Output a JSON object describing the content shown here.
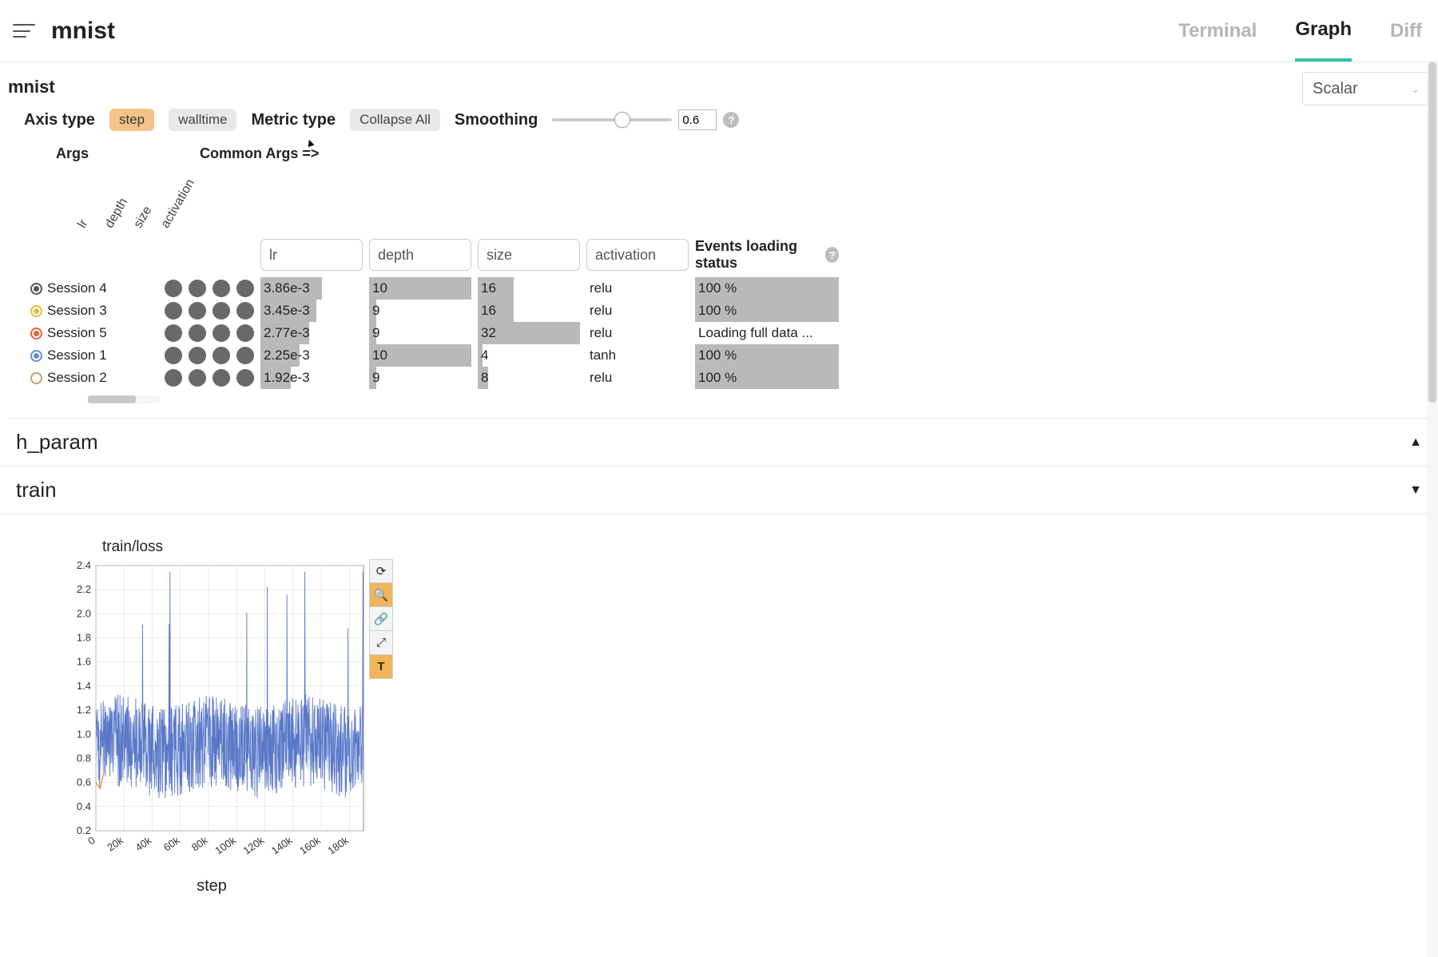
{
  "header": {
    "title": "mnist",
    "tabs": [
      {
        "label": "Terminal",
        "active": false
      },
      {
        "label": "Graph",
        "active": true
      },
      {
        "label": "Diff",
        "active": false
      }
    ]
  },
  "breadcrumb": "mnist",
  "tag_dropdown": "Scalar",
  "controls": {
    "axis_type_label": "Axis type",
    "axis_options": [
      {
        "label": "step",
        "active": true
      },
      {
        "label": "walltime",
        "active": false
      }
    ],
    "metric_type_label": "Metric type",
    "collapse_label": "Collapse All",
    "smoothing_label": "Smoothing",
    "smoothing_value": "0.6"
  },
  "args": {
    "heading": "Args",
    "common_label": "Common Args =>",
    "columns": [
      "lr",
      "depth",
      "size",
      "activation"
    ],
    "status_label": "Events loading status",
    "sessions": [
      {
        "name": "Session 4",
        "color": "#555",
        "selected": true,
        "lr": "3.86e-3",
        "lr_w": 60,
        "depth": "10",
        "depth_w": 100,
        "size": "16",
        "size_w": 35,
        "activation": "relu",
        "status": "100 %",
        "status_bar": true
      },
      {
        "name": "Session 3",
        "color": "#e0c040",
        "selected": true,
        "lr": "3.45e-3",
        "lr_w": 55,
        "depth": "9",
        "depth_w": 7,
        "size": "16",
        "size_w": 35,
        "activation": "relu",
        "status": "100 %",
        "status_bar": true
      },
      {
        "name": "Session 5",
        "color": "#e1643a",
        "selected": true,
        "lr": "2.77e-3",
        "lr_w": 48,
        "depth": "9",
        "depth_w": 7,
        "size": "32",
        "size_w": 100,
        "activation": "relu",
        "status": "Loading full data ...",
        "status_bar": false
      },
      {
        "name": "Session 1",
        "color": "#6a8ed8",
        "selected": true,
        "lr": "2.25e-3",
        "lr_w": 38,
        "depth": "10",
        "depth_w": 100,
        "size": "4",
        "size_w": 5,
        "activation": "tanh",
        "status": "100 %",
        "status_bar": true
      },
      {
        "name": "Session 2",
        "color": "#ffffff",
        "selected": false,
        "lr": "1.92e-3",
        "lr_w": 30,
        "depth": "9",
        "depth_w": 7,
        "size": "8",
        "size_w": 10,
        "activation": "relu",
        "status": "100 %",
        "status_bar": true
      }
    ]
  },
  "sections": [
    {
      "title": "h_param",
      "open": false,
      "icon": "▲"
    },
    {
      "title": "train",
      "open": true,
      "icon": "▼"
    }
  ],
  "chart_data": {
    "type": "line",
    "title": "train/loss",
    "xlabel": "step",
    "ylabel": "",
    "xlim": [
      0,
      190000
    ],
    "ylim": [
      0.2,
      2.4
    ],
    "xticks": [
      "0",
      "20k",
      "40k",
      "60k",
      "80k",
      "100k",
      "120k",
      "140k",
      "160k",
      "180k"
    ],
    "yticks": [
      "0.2",
      "0.4",
      "0.6",
      "0.8",
      "1.0",
      "1.2",
      "1.4",
      "1.6",
      "1.8",
      "2.0",
      "2.2",
      "2.4"
    ],
    "series": [
      {
        "name": "Session 1",
        "color": "#6a8ed8",
        "note": "noisy loss oscillating roughly between 0.5 and 1.6 with occasional spikes up to ~2.3; mean around 0.9 across 0–190k steps"
      }
    ]
  },
  "chart_toolbar": [
    "refresh",
    "zoom",
    "link",
    "expand",
    "text"
  ]
}
